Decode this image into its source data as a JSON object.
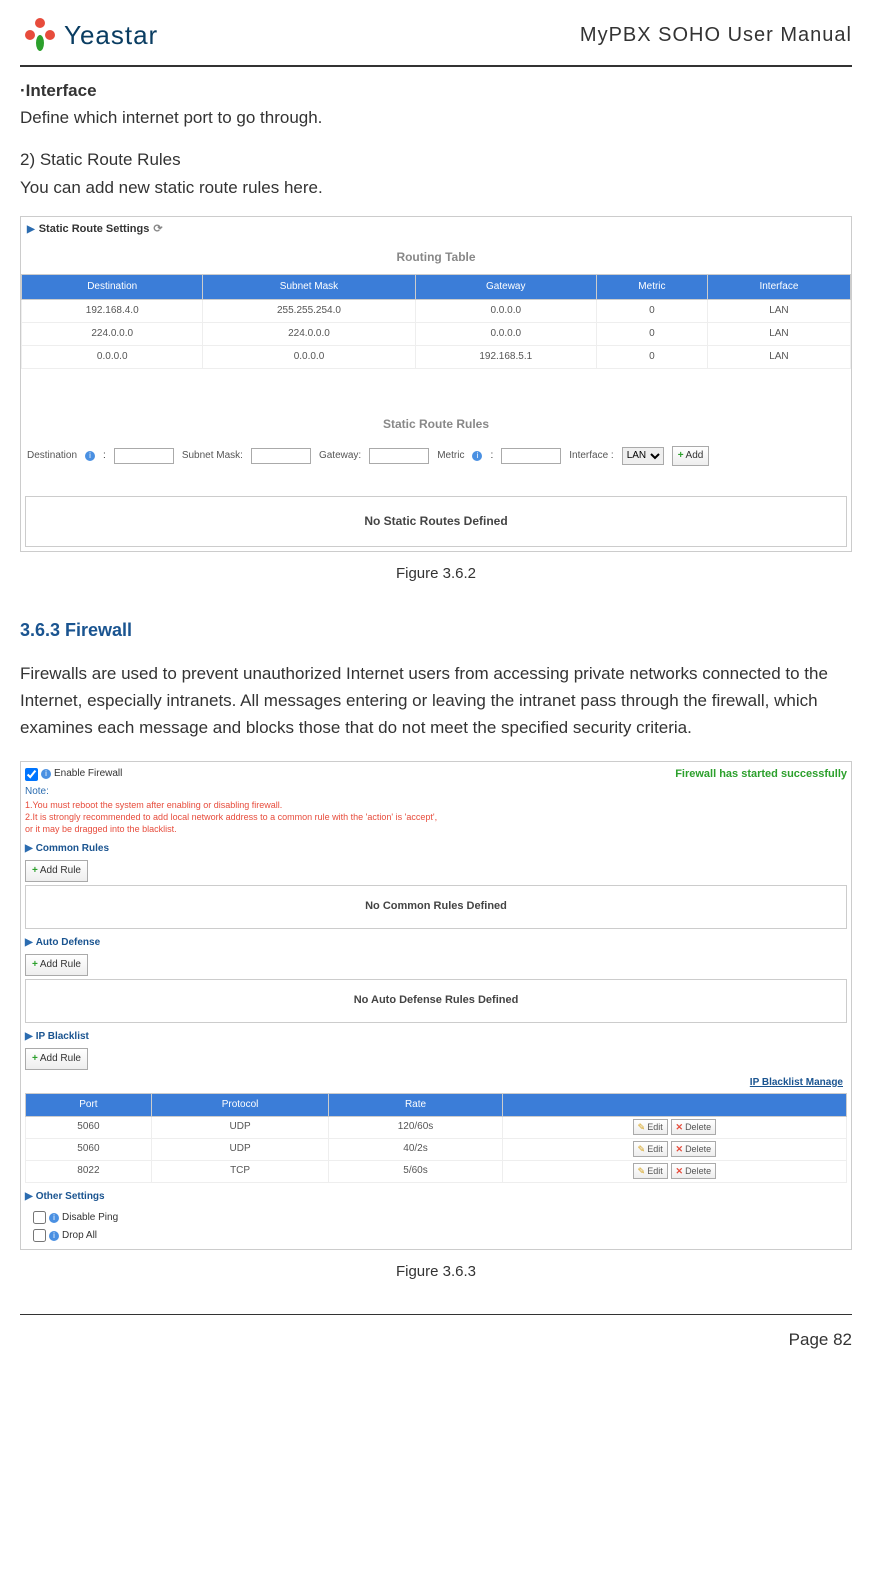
{
  "header": {
    "logo_text": "Yeastar",
    "doc_title": "MyPBX SOHO User Manual"
  },
  "interface": {
    "heading": "·Interface",
    "desc": "Define which internet port to go through."
  },
  "static_route": {
    "heading": "2)  Static Route Rules",
    "desc": "You can add new static route rules here."
  },
  "fig1": {
    "panel_title": "Static Route Settings",
    "sub1": "Routing Table",
    "columns": [
      "Destination",
      "Subnet Mask",
      "Gateway",
      "Metric",
      "Interface"
    ],
    "rows": [
      [
        "192.168.4.0",
        "255.255.254.0",
        "0.0.0.0",
        "0",
        "LAN"
      ],
      [
        "224.0.0.0",
        "224.0.0.0",
        "0.0.0.0",
        "0",
        "LAN"
      ],
      [
        "0.0.0.0",
        "0.0.0.0",
        "192.168.5.1",
        "0",
        "LAN"
      ]
    ],
    "sub2": "Static Route Rules",
    "form": {
      "destination": "Destination",
      "subnet": "Subnet Mask:",
      "gateway": "Gateway:",
      "metric": "Metric",
      "interface": "Interface :",
      "interface_value": "LAN",
      "add": "Add"
    },
    "no_rules": "No Static Routes Defined",
    "caption": "Figure 3.6.2"
  },
  "firewall_section": {
    "title": "3.6.3 Firewall",
    "desc": "Firewalls are used to prevent unauthorized Internet users from accessing private networks connected to the Internet, especially intranets. All messages entering or leaving the intranet pass through the firewall, which examines each message and blocks those that do not meet the specified security criteria."
  },
  "fig2": {
    "enable_label": "Enable Firewall",
    "note_label": "Note:",
    "note_1": "1.You must reboot the system after enabling or disabling firewall.",
    "note_2": "2.It is strongly recommended to add local network address to a common rule with the 'action' is 'accept',",
    "note_3": "or it may be dragged into the blacklist.",
    "status": "Firewall has started successfully",
    "common_rules_title": "Common Rules",
    "add_rule": "Add Rule",
    "no_common": "No Common Rules Defined",
    "auto_defense_title": "Auto Defense",
    "no_auto": "No Auto Defense Rules Defined",
    "ip_blacklist_title": "IP Blacklist",
    "ip_manage": "IP Blacklist Manage",
    "bl_columns": [
      "Port",
      "Protocol",
      "Rate"
    ],
    "bl_rows": [
      [
        "5060",
        "UDP",
        "120/60s"
      ],
      [
        "5060",
        "UDP",
        "40/2s"
      ],
      [
        "8022",
        "TCP",
        "5/60s"
      ]
    ],
    "edit": "Edit",
    "delete": "Delete",
    "other_title": "Other Settings",
    "disable_ping": "Disable Ping",
    "drop_all": "Drop All",
    "caption": "Figure 3.6.3"
  },
  "footer": {
    "page": "Page 82"
  }
}
